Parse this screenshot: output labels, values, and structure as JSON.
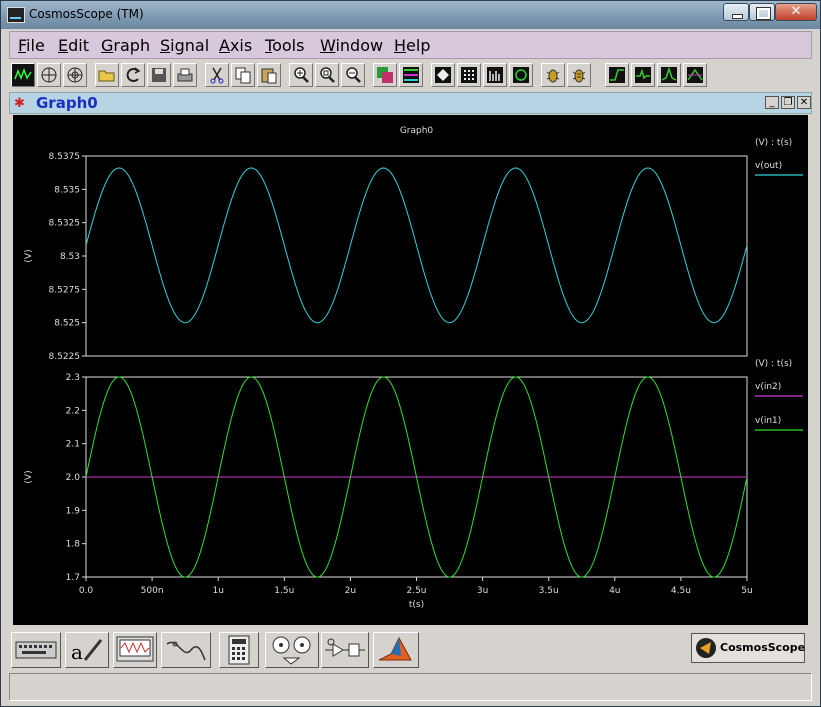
{
  "window": {
    "title": "CosmosScope (TM)"
  },
  "menu": [
    "File",
    "Edit",
    "Graph",
    "Signal",
    "Axis",
    "Tools",
    "Window",
    "Help"
  ],
  "toolbar_icons": [
    "waveform-icon",
    "grid-icon",
    "polar-icon",
    "open-folder-icon",
    "reload-icon",
    "save-icon",
    "print-icon",
    "cut-icon",
    "copy-icon",
    "paste-icon",
    "zoom-in-icon",
    "zoom-fit-icon",
    "zoom-out-icon",
    "stack-icon",
    "color-bars-icon",
    "diamond-icon",
    "dot-grid-icon",
    "bar-grid-icon",
    "cycle-icon",
    "bug-icon",
    "bug-list-icon",
    "measure-rise-icon",
    "measure-pulse-icon",
    "measure-peak-icon",
    "measure-cross-icon"
  ],
  "graph_window": {
    "title": "Graph0"
  },
  "colors": {
    "cyan": "#35d0dd",
    "green": "#2ee02a",
    "magenta": "#d23ad2"
  },
  "chart_data": [
    {
      "type": "line",
      "title": "Graph0",
      "ylabel": "(V)",
      "axis_note": "(V) : t(s)",
      "ylim": [
        8.5225,
        8.5375
      ],
      "yticks": [
        "8.5375",
        "8.535",
        "8.5325",
        "8.53",
        "8.5275",
        "8.525",
        "8.5225"
      ],
      "xlim": [
        0,
        5e-06
      ],
      "grid": false,
      "legend_position": "right",
      "series": [
        {
          "name": "v(out)",
          "color": "#35d0dd",
          "waveform": "sine",
          "offset": 8.5308,
          "amplitude": 0.0058,
          "period": 1e-06,
          "phase": 0
        }
      ]
    },
    {
      "type": "line",
      "ylabel": "(V)",
      "axis_note": "(V) : t(s)",
      "ylim": [
        1.7,
        2.3
      ],
      "yticks": [
        "2.3",
        "2.2",
        "2.1",
        "2.0",
        "1.9",
        "1.8",
        "1.7"
      ],
      "xlabel": "t(s)",
      "xlim": [
        0,
        5e-06
      ],
      "xticks": [
        "0.0",
        "500n",
        "1u",
        "1.5u",
        "2u",
        "2.5u",
        "3u",
        "3.5u",
        "4u",
        "4.5u",
        "5u"
      ],
      "grid": false,
      "legend_position": "right",
      "series": [
        {
          "name": "v(in2)",
          "color": "#d23ad2",
          "waveform": "constant",
          "value": 2.0
        },
        {
          "name": "v(in1)",
          "color": "#2ee02a",
          "waveform": "sine",
          "offset": 2.0,
          "amplitude": 0.3,
          "period": 1e-06,
          "phase": 0
        }
      ]
    }
  ],
  "logo": {
    "text": "CosmosScope"
  }
}
